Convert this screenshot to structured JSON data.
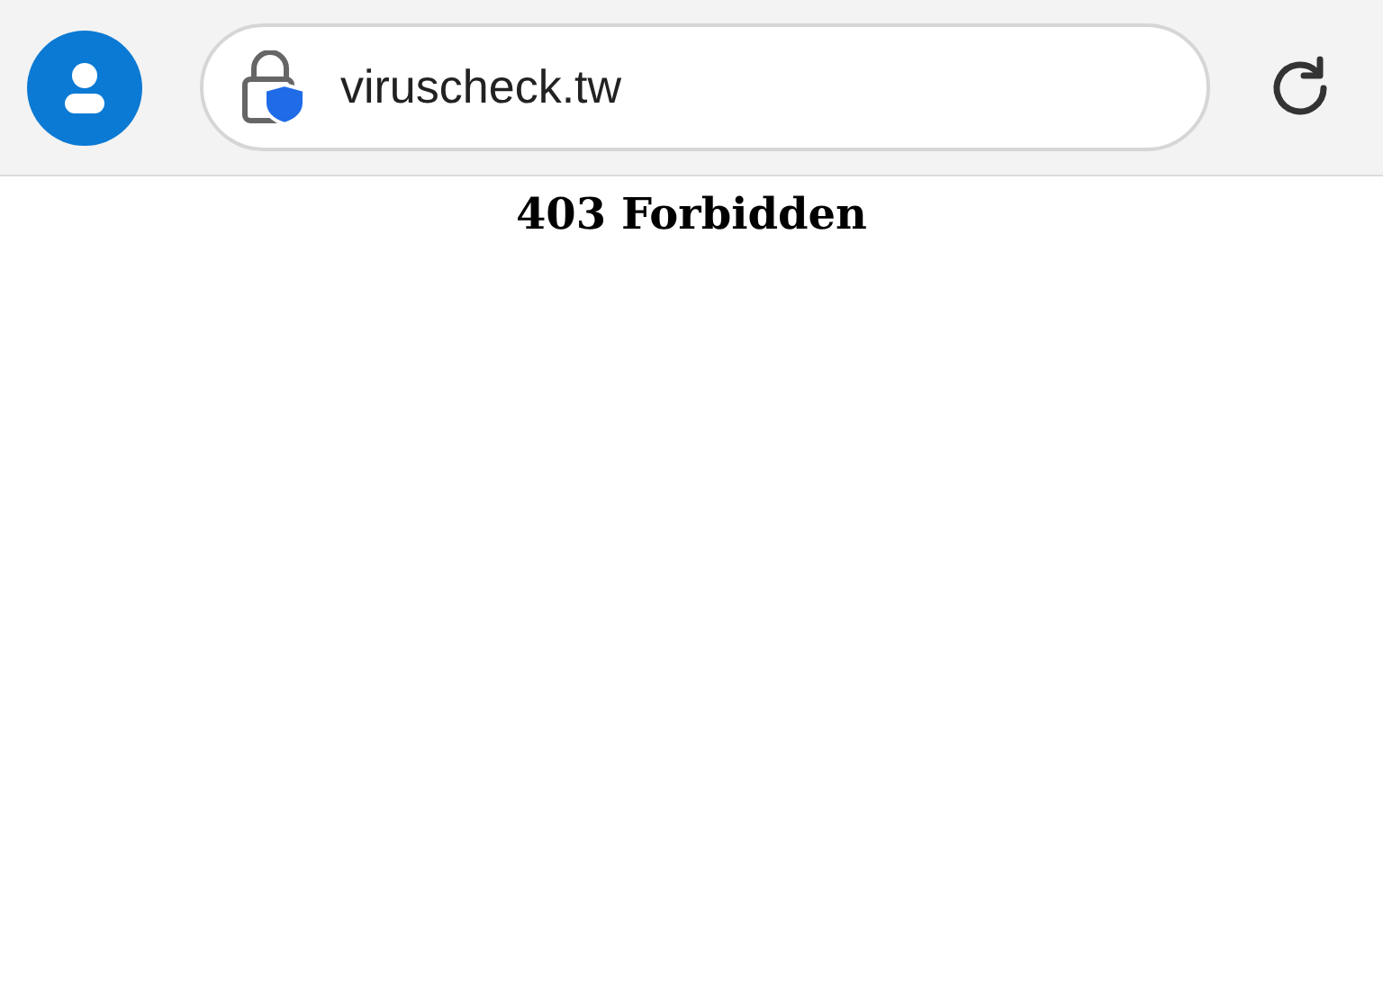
{
  "address_bar": {
    "url": "viruscheck.tw"
  },
  "page": {
    "heading": "403 Forbidden"
  }
}
